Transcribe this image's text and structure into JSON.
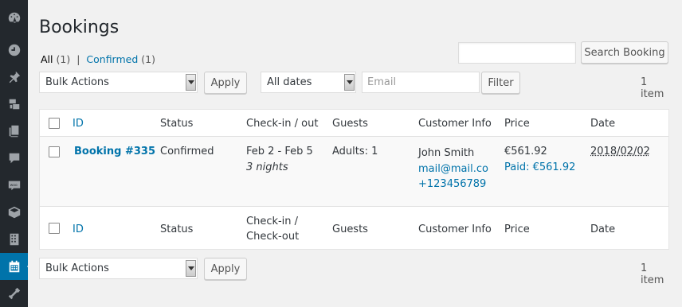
{
  "sidebar": {
    "icons": [
      "dashboard-icon",
      "plugin-icon",
      "pin-icon",
      "media-icon",
      "pages-icon",
      "comments-icon",
      "woo-icon",
      "package-icon",
      "building-icon",
      "calendar-icon",
      "tools-icon"
    ],
    "active": "calendar-icon"
  },
  "page": {
    "title": "Bookings"
  },
  "views": {
    "all_label": "All",
    "all_count": "(1)",
    "separator": "|",
    "confirmed_label": "Confirmed",
    "confirmed_count": "(1)"
  },
  "search": {
    "button": "Search Booking",
    "value": ""
  },
  "toolbar_top": {
    "bulk_actions": "Bulk Actions",
    "apply": "Apply",
    "dates": "All dates",
    "email_placeholder": "Email",
    "filter": "Filter",
    "items": "1 item"
  },
  "table": {
    "header": {
      "id": "ID",
      "status": "Status",
      "checkin": "Check-in / out",
      "guests": "Guests",
      "customer": "Customer Info",
      "price": "Price",
      "date": "Date"
    },
    "rows": [
      {
        "id": "Booking #335",
        "status": "Confirmed",
        "checkin": "Feb 2 - Feb 5",
        "nights": "3 nights",
        "guests": "Adults: 1",
        "customer_name": "John Smith",
        "customer_email": "mail@mail.co",
        "customer_phone": "+123456789",
        "price": "€561.92",
        "paid": "Paid: €561.92",
        "date": "2018/02/02"
      }
    ],
    "footer": {
      "id": "ID",
      "status": "Status",
      "checkin_line1": "Check-in /",
      "checkin_line2": "Check-out",
      "guests": "Guests",
      "customer": "Customer Info",
      "price": "Price",
      "date": "Date"
    }
  },
  "toolbar_bottom": {
    "bulk_actions": "Bulk Actions",
    "apply": "Apply",
    "items": "1 item"
  },
  "colors": {
    "accent": "#0073aa",
    "sidebar_bg": "#23282d",
    "page_bg": "#f1f1f1"
  }
}
